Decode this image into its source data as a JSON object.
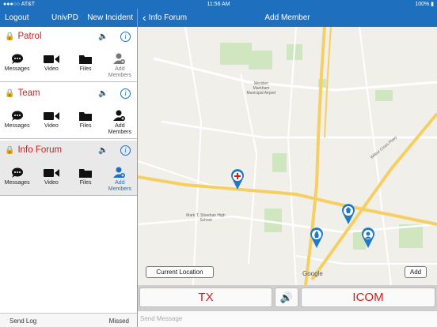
{
  "status": {
    "carrier": "●●●○○ AT&T",
    "time": "11:56 AM",
    "battery": "100%"
  },
  "left_nav": {
    "logout": "Logout",
    "title": "UnivPD",
    "new_incident": "New Incident"
  },
  "right_nav": {
    "back": "Info Forum",
    "title": "Add Member"
  },
  "groups": [
    {
      "name": "Patrol",
      "actions": [
        "Messages",
        "Video",
        "Files",
        "Add Members"
      ]
    },
    {
      "name": "Team",
      "actions": [
        "Messages",
        "Video",
        "Files",
        "Add Members"
      ]
    },
    {
      "name": "Info Forum",
      "actions": [
        "Messages",
        "Video",
        "Files",
        "Add Members"
      ]
    }
  ],
  "bottom": {
    "send_log": "Send Log",
    "missed": "Missed"
  },
  "map": {
    "labels": [
      "Meriden Markham Municipal Airport",
      "Mark T. Sheehan High School",
      "Wilbur Cross Pkwy",
      "Google"
    ],
    "current_location": "Current Location",
    "add": "Add"
  },
  "ptt": {
    "tx": "TX",
    "icom": "ICOM",
    "send_placeholder": "Send Message"
  },
  "colors": {
    "brand": "#1f6fbf",
    "group_name": "#d11c1c",
    "pin": "#1f78c8"
  }
}
